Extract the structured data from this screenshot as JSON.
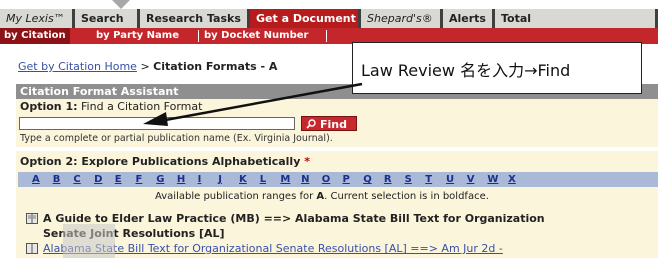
{
  "tabs": [
    {
      "label": "My Lexis™",
      "italic": true
    },
    {
      "label": "Search"
    },
    {
      "label": "Research Tasks"
    },
    {
      "label": "Get a Document",
      "active": true
    },
    {
      "label": "Shepard's®",
      "italic": true
    },
    {
      "label": "Alerts"
    },
    {
      "label": "Total"
    }
  ],
  "subnav": {
    "by_citation": "by Citation",
    "by_party_name": "by Party Name",
    "by_docket_number": "by Docket Number"
  },
  "breadcrumb": {
    "home_link": "Get by Citation Home",
    "separator": ">",
    "current": "Citation Formats - A"
  },
  "panel": {
    "title": "Citation Format Assistant",
    "option1_label": "Option 1:",
    "option1_text": "Find a Citation Format",
    "search_value": "",
    "find_label": "Find",
    "hint": "Type a complete or partial publication name (Ex. Virginia Journal).",
    "option2_label": "Option 2:",
    "option2_text": "Explore Publications Alphabetically",
    "required_mark": "*",
    "letters": [
      "A",
      "B",
      "C",
      "D",
      "E",
      "F",
      "G",
      "H",
      "I",
      "J",
      "K",
      "L",
      "M",
      "N",
      "O",
      "P",
      "Q",
      "R",
      "S",
      "T",
      "U",
      "V",
      "W",
      "X"
    ],
    "ranges_text_pre": "Available publication ranges for",
    "ranges_letter": "A",
    "ranges_text_post": ". Current selection is in boldface.",
    "pub1_line1": "A Guide to Elder Law Practice (MB) ==> Alabama State Bill Text for Organization",
    "pub1_line2": "Senate Joint Resolutions [AL]",
    "pub2": "Alabama State Bill Text for Organizational Senate Resolutions [AL] ==> Am Jur 2d -"
  },
  "callout": {
    "text": "Law Review 名を入力→Find"
  },
  "colors": {
    "tab_active": "#b71c1c",
    "subnav": "#c3262b",
    "panel_bg": "#fbf5dc",
    "alpha_bar": "#a9b9d7"
  }
}
